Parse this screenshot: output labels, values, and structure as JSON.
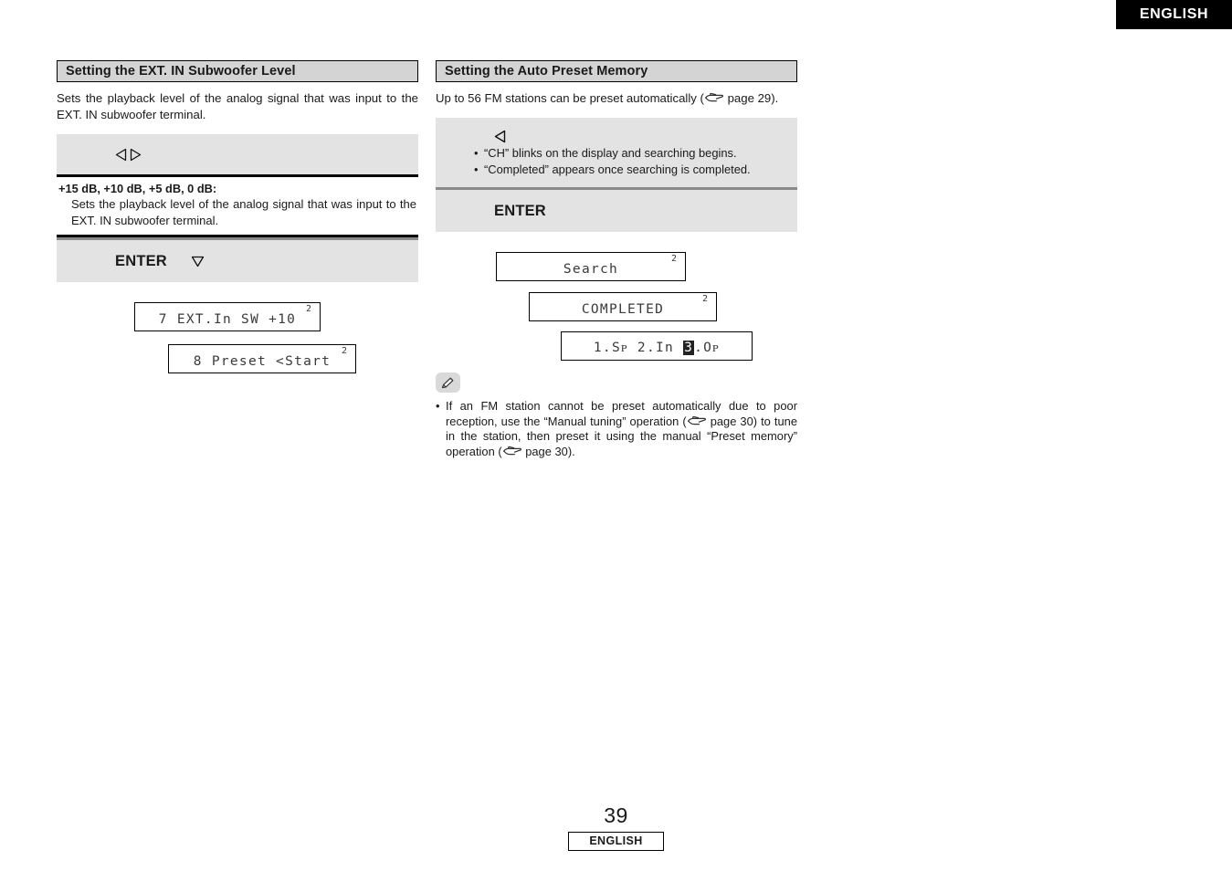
{
  "header": {
    "language_tab": "ENGLISH"
  },
  "left_column": {
    "heading": "Setting the EXT. IN Subwoofer Level",
    "intro": "Sets the playback level of the analog signal that was input to the EXT. IN subwoofer terminal.",
    "panel": {
      "arrows_row": {
        "left_arrow_icon": "left-triangle-icon",
        "right_arrow_icon": "right-triangle-icon"
      },
      "definition": {
        "term": "+15 dB, +10 dB, +5 dB, 0 dB:",
        "description": "Sets the playback level of the analog signal that was input to the EXT. IN subwoofer terminal."
      },
      "enter_row": {
        "label": "ENTER",
        "down_arrow_icon": "down-triangle-icon"
      }
    },
    "displays": [
      {
        "text": "7 EXT.In SW +10",
        "superscript": "2"
      },
      {
        "text": "8 Preset <Start",
        "superscript": "2"
      }
    ]
  },
  "right_column": {
    "heading": "Setting the Auto Preset Memory",
    "intro_before": "Up to 56 FM stations can be preset automatically (",
    "intro_icon": "pointing-hand-icon",
    "intro_after": " page 29).",
    "panel": {
      "arrow_row": {
        "left_arrow_icon": "left-triangle-icon"
      },
      "bullets": [
        "“CH” blinks on the display and searching begins.",
        "“Completed” appears once searching is completed."
      ],
      "enter_row": {
        "label": "ENTER"
      }
    },
    "displays": [
      {
        "text": "Search",
        "superscript": "2"
      },
      {
        "text": "COMPLETED",
        "superscript": "2"
      },
      {
        "text_part1": "1.Sᴘ 2.In ",
        "highlight": "3",
        "text_part2": ".Oᴘ",
        "superscript": ""
      }
    ],
    "note": {
      "icon": "pencil-icon",
      "segment1": "If an FM station cannot be preset automatically due to poor reception, use the “Manual tuning” operation (",
      "icon1": "pointing-hand-icon",
      "segment2": " page 30) to tune in the station, then preset it using the manual “Preset memory” operation (",
      "icon2": "pointing-hand-icon",
      "segment3": " page 30)."
    }
  },
  "footer": {
    "page_number": "39",
    "language": "ENGLISH"
  },
  "colors": {
    "panel_grey": "#e3e3e3",
    "heading_grey": "#d4d4d4",
    "rule_grey": "#8a8a8a",
    "black": "#000000"
  }
}
